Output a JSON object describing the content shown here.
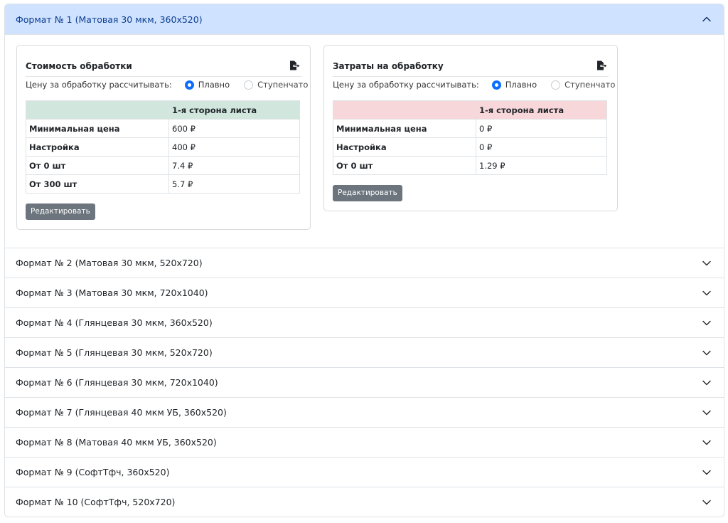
{
  "accordion": {
    "open_item": {
      "title": "Формат № 1 (Матовая 30 мкм, 360x520)",
      "cards": [
        {
          "title": "Стоимость обработки",
          "price_label": "Цену за обработку рассчитывать:",
          "options": [
            {
              "label": "Плавно",
              "selected": true
            },
            {
              "label": "Ступенчато",
              "selected": false
            }
          ],
          "table_header": "1-я сторона листа",
          "rows": [
            {
              "label": "Минимальная цена",
              "value": "600 ₽"
            },
            {
              "label": "Настройка",
              "value": "400 ₽"
            },
            {
              "label": "От 0 шт",
              "value": "7.4 ₽"
            },
            {
              "label": "От 300 шт",
              "value": "5.7 ₽"
            }
          ],
          "edit_label": "Редактировать"
        },
        {
          "title": "Затраты на обработку",
          "price_label": "Цену за обработку рассчитывать:",
          "options": [
            {
              "label": "Плавно",
              "selected": true
            },
            {
              "label": "Ступенчато",
              "selected": false
            }
          ],
          "table_header": "1-я сторона листа",
          "rows": [
            {
              "label": "Минимальная цена",
              "value": "0 ₽"
            },
            {
              "label": "Настройка",
              "value": "0 ₽"
            },
            {
              "label": "От 0 шт",
              "value": "1.29 ₽"
            }
          ],
          "edit_label": "Редактировать"
        }
      ]
    },
    "collapsed_items": [
      "Формат № 2 (Матовая 30 мкм, 520x720)",
      "Формат № 3 (Матовая 30 мкм, 720x1040)",
      "Формат № 4 (Глянцевая 30 мкм, 360x520)",
      "Формат № 5 (Глянцевая 30 мкм, 520x720)",
      "Формат № 6 (Глянцевая 30 мкм, 720x1040)",
      "Формат № 7 (Глянцевая 40 мкм УБ, 360x520)",
      "Формат № 8 (Матовая 40 мкм УБ, 360x520)",
      "Формат № 9 (СофтТфч, 360x520)",
      "Формат № 10 (СофтТфч, 520x720)"
    ]
  },
  "colors": {
    "open_header_bg": "#cfe2ff",
    "cost_table_header_bg": "#d1e7dd",
    "expense_table_header_bg": "#f8d7da",
    "radio_accent": "#0d6efd",
    "button_bg": "#6c757d"
  },
  "icons": {
    "open_chevron": "chevron-up-icon",
    "collapsed_chevron": "chevron-down-icon",
    "card_action": "file-export-icon"
  }
}
